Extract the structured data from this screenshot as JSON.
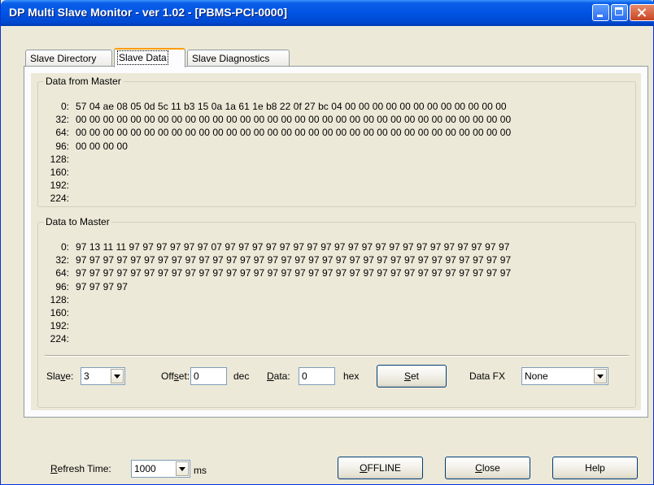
{
  "window": {
    "title": "DP Multi Slave Monitor - ver 1.02 - [PBMS-PCI-0000]"
  },
  "tabs": [
    {
      "label": "Slave Directory"
    },
    {
      "label": "Slave Data"
    },
    {
      "label": "Slave Diagnostics"
    }
  ],
  "from_master": {
    "legend": "Data from Master",
    "rows": [
      {
        "offset": "0:",
        "bytes": "57 04 ae 08 05 0d 5c 11 b3 15 0a 1a 61 1e b8 22 0f 27 bc 04 00 00 00 00 00 00 00 00 00 00 00 00"
      },
      {
        "offset": "32:",
        "bytes": "00 00 00 00 00 00 00 00 00 00 00 00 00 00 00 00 00 00 00 00 00 00 00 00 00 00 00 00 00 00 00 00"
      },
      {
        "offset": "64:",
        "bytes": "00 00 00 00 00 00 00 00 00 00 00 00 00 00 00 00 00 00 00 00 00 00 00 00 00 00 00 00 00 00 00 00"
      },
      {
        "offset": "96:",
        "bytes": "00 00 00 00"
      },
      {
        "offset": "128:",
        "bytes": ""
      },
      {
        "offset": "160:",
        "bytes": ""
      },
      {
        "offset": "192:",
        "bytes": ""
      },
      {
        "offset": "224:",
        "bytes": ""
      }
    ]
  },
  "to_master": {
    "legend": "Data to Master",
    "rows": [
      {
        "offset": "0:",
        "bytes": "97 13 11 11 97 97 97 97 97 97 07 97 97 97 97 97 97 97 97 97 97 97 97 97 97 97 97 97 97 97 97 97"
      },
      {
        "offset": "32:",
        "bytes": "97 97 97 97 97 97 97 97 97 97 97 97 97 97 97 97 97 97 97 97 97 97 97 97 97 97 97 97 97 97 97 97"
      },
      {
        "offset": "64:",
        "bytes": "97 97 97 97 97 97 97 97 97 97 97 97 97 97 97 97 97 97 97 97 97 97 97 97 97 97 97 97 97 97 97 97"
      },
      {
        "offset": "96:",
        "bytes": "97 97 97 97"
      },
      {
        "offset": "128:",
        "bytes": ""
      },
      {
        "offset": "160:",
        "bytes": ""
      },
      {
        "offset": "192:",
        "bytes": ""
      },
      {
        "offset": "224:",
        "bytes": ""
      }
    ]
  },
  "controls": {
    "slave_pre": "Sla",
    "slave_ul": "v",
    "slave_post": "e:",
    "slave_value": "3",
    "offset_pre": "Off",
    "offset_ul": "s",
    "offset_post": "et:",
    "offset_value": "0",
    "offset_unit": "dec",
    "data_ul": "D",
    "data_post": "ata:",
    "data_value": "0",
    "data_unit": "hex",
    "set_ul": "S",
    "set_post": "et",
    "datafx_label": "Data FX",
    "datafx_value": "None"
  },
  "footer": {
    "refresh_ul": "R",
    "refresh_post": "efresh Time:",
    "refresh_value": "1000",
    "refresh_unit": "ms",
    "offline_ul": "O",
    "offline_post": "FFLINE",
    "close_ul": "C",
    "close_post": "lose",
    "help_label": "Help"
  }
}
